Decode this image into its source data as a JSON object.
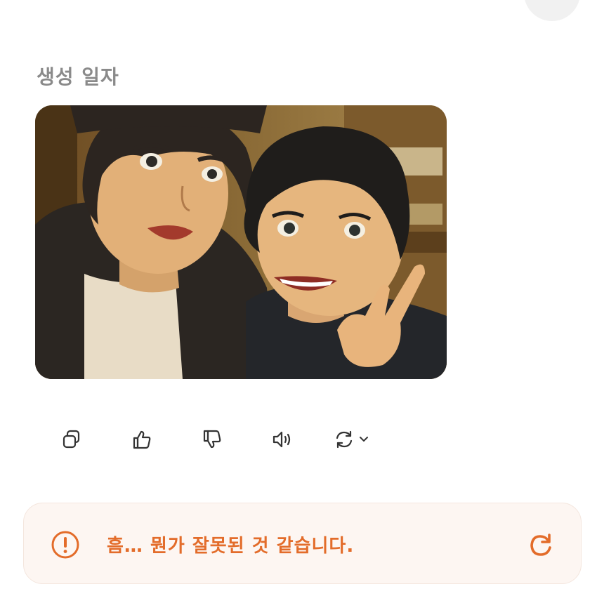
{
  "section": {
    "label": "생성 일자"
  },
  "image": {
    "description": "anime-style selfie of a man and a smiling child making a peace sign"
  },
  "actions": [
    {
      "name": "copy-icon"
    },
    {
      "name": "thumbs-up-icon"
    },
    {
      "name": "thumbs-down-icon"
    },
    {
      "name": "speaker-icon"
    },
    {
      "name": "regenerate-icon"
    }
  ],
  "alert": {
    "message": "흠… 뭔가 잘못된 것 같습니다.",
    "icon": "exclamation-circle-icon",
    "retry_icon": "refresh-icon",
    "accent": "#e36c2a"
  },
  "colors": {
    "label": "#8a8a8a",
    "icon": "#333333",
    "alert_bg": "#fdf6f2"
  }
}
